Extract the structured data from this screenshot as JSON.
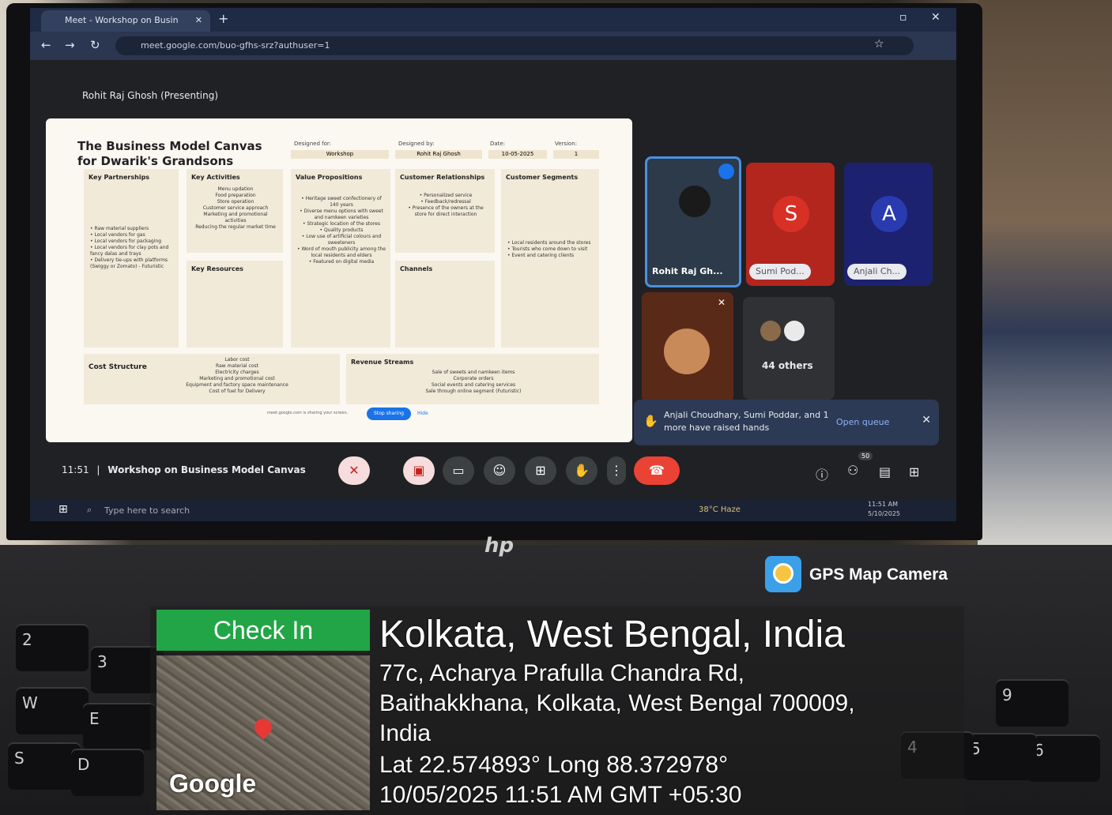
{
  "browser": {
    "tab_title": "Meet - Workshop on Busin",
    "url": "meet.google.com/buo-gfhs-srz?authuser=1"
  },
  "meet": {
    "presenter_label": "Rohit Raj Ghosh (Presenting)",
    "meeting_time": "11:51",
    "meeting_title": "Workshop on Business Model Canvas",
    "raised_hands": "Anjali Choudhary, Sumi Poddar, and 1 more have raised hands",
    "open_queue": "Open queue",
    "participant_count": "50",
    "stop_sharing": "Stop sharing",
    "hide": "Hide",
    "sharing_notice": "meet.google.com is sharing your screen.",
    "participants": [
      {
        "name": "Rohit Raj Gh...",
        "initial": ""
      },
      {
        "name": "Sumi Pod...",
        "initial": "S",
        "color": "#d93025"
      },
      {
        "name": "Anjali Ch...",
        "initial": "A",
        "color": "#1a2a8f"
      }
    ],
    "others_label": "44 others"
  },
  "slide": {
    "title": "The Business Model Canvas for Dwarik's Grandsons",
    "designed_for_label": "Designed for:",
    "designed_for": "Workshop",
    "designed_by_label": "Designed by:",
    "designed_by": "Rohit Raj Ghosh",
    "date_label": "Date:",
    "date": "10-05-2025",
    "version_label": "Version:",
    "version": "1",
    "key_partnerships": "Key Partnerships",
    "key_partnerships_text": "• Raw material suppliers\n• Local vendors for gas\n• Local vendors for packaging\n• Local vendors for clay pots and fancy dalas and trays\n• Delivery tie-ups with platforms (Swiggy or Zomato) - Futuristic",
    "key_activities": "Key Activities",
    "key_activities_text": "Menu updation\nFood preparation\nStore operation\nCustomer service approach\nMarketing and promotional activities\nReducing the regular market time",
    "key_resources": "Key Resources",
    "value_propositions": "Value Propositions",
    "value_propositions_text": "• Heritage sweet confectionery of 140 years\n• Diverse menu options with sweet and namkeen varieties\n• Strategic location of the stores\n• Quality products\n• Low use of artificial colours and sweeteners\n• Word of mouth publicity among the local residents and elders\n• Featured on digital media",
    "customer_relationships": "Customer Relationships",
    "customer_relationships_text": "• Personalized service\n• Feedback/redressal\n• Presence of the owners at the store for direct interaction",
    "channels": "Channels",
    "customer_segments": "Customer Segments",
    "customer_segments_text": "• Local residents around the stores\n• Tourists who come down to visit\n• Event and catering clients",
    "cost_structure": "Cost Structure",
    "cost_structure_text": "Labor cost\nRaw material cost\nElectricity charges\nMarketing and promotional cost\nEquipment and factory space maintenance\nCost of fuel for Delivery",
    "revenue_streams": "Revenue Streams",
    "revenue_streams_text": "Sale of sweets and namkeen items\nCorporate orders\nSocial events and catering services\nSale through online segment (Futuristic)"
  },
  "taskbar": {
    "search_placeholder": "Type here to search",
    "weather": "38°C Haze",
    "clock_time": "11:51 AM",
    "clock_date": "5/10/2025"
  },
  "laptop": {
    "brand": "hp"
  },
  "gps": {
    "app_name": "GPS Map Camera",
    "check_in": "Check In",
    "city": "Kolkata, West Bengal, India",
    "address_line1": "77c, Acharya Prafulla Chandra Rd,",
    "address_line2": "Baithakkhana, Kolkata, West Bengal 700009,",
    "address_line3": "India",
    "latlong": "Lat 22.574893° Long 88.372978°",
    "timestamp": "10/05/2025 11:51 AM GMT +05:30",
    "map_provider": "Google"
  },
  "keys": [
    "2",
    "3",
    "W",
    "E",
    "S",
    "D",
    "9",
    "6",
    "5",
    "4"
  ]
}
